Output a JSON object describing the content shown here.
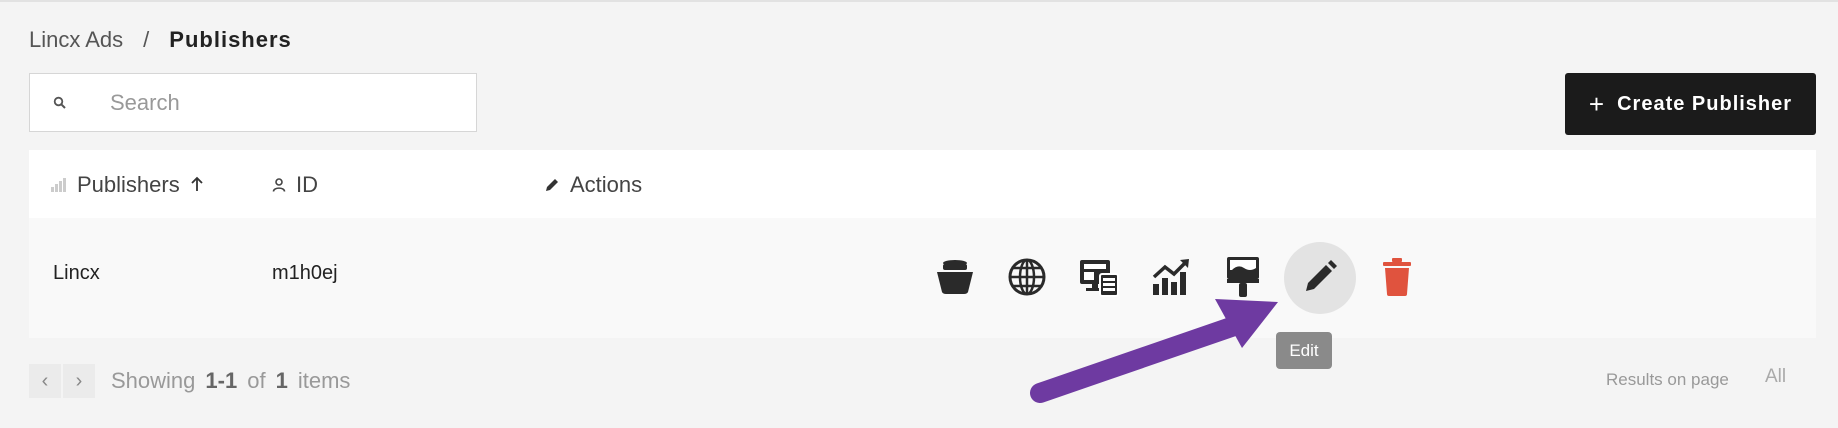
{
  "breadcrumb": {
    "parent": "Lincx Ads",
    "separator": "/",
    "current": "Publishers"
  },
  "search": {
    "placeholder": "Search",
    "value": ""
  },
  "toolbar": {
    "create_label": "Create Publisher"
  },
  "table": {
    "columns": [
      {
        "label": "Publishers",
        "icon": "bar-chart-icon",
        "sort": "ascending"
      },
      {
        "label": "ID",
        "icon": "user-icon"
      },
      {
        "label": "Actions",
        "icon": "pencil-icon"
      }
    ],
    "rows": [
      {
        "name": "Lincx",
        "id": "m1h0ej"
      }
    ],
    "row_actions": [
      "bucket-icon",
      "globe-icon",
      "ad-units-icon",
      "analytics-icon",
      "paint-brush-icon",
      "edit-icon",
      "trash-icon"
    ]
  },
  "tooltip": {
    "text": "Edit"
  },
  "pagination": {
    "showing": "Showing",
    "range_start": "1",
    "range_sep": "-",
    "range_end": "1",
    "of": "of",
    "total": "1",
    "items": "items"
  },
  "results": {
    "label": "Results on page",
    "value": "All"
  },
  "colors": {
    "annotation_arrow": "#6e3aa1",
    "delete": "#e0533e",
    "primary_button": "#1b1b1b"
  }
}
